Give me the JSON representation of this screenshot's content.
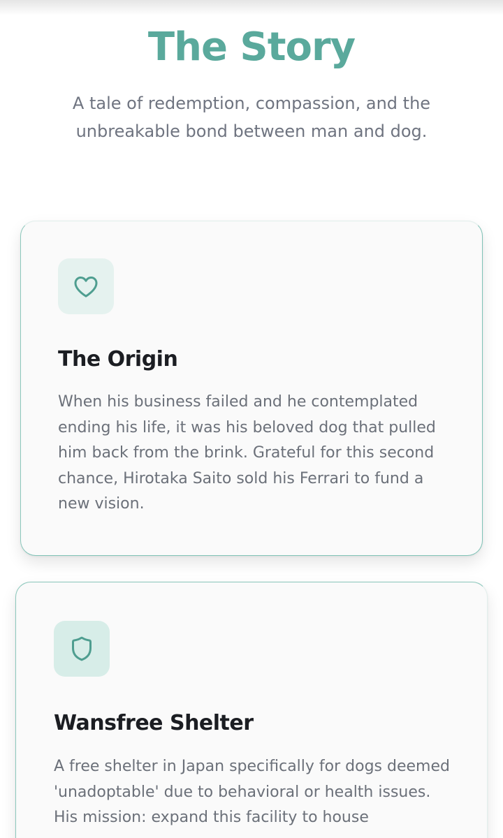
{
  "section": {
    "title": "The Story",
    "subtitle": "A tale of redemption, compassion, and the unbreakable bond between man and dog."
  },
  "cards": [
    {
      "icon": "heart-icon",
      "title": "The Origin",
      "text": "When his business failed and he contemplated ending his life, it was his beloved dog that pulled him back from the brink. Grateful for this second chance, Hirotaka Saito sold his Ferrari to fund a new vision."
    },
    {
      "icon": "shield-icon",
      "title": "Wansfree Shelter",
      "text": "A free shelter in Japan specifically for dogs deemed 'unadoptable' due to behavioral or health issues. His mission: expand this facility to house"
    }
  ],
  "colors": {
    "accent": "#5aa99c",
    "icon_stroke": "#4f9e90",
    "heading": "#1b1d22",
    "body_text": "#6b7079",
    "card_bg": "#fafafa",
    "card_border": "#9fcfc6"
  }
}
